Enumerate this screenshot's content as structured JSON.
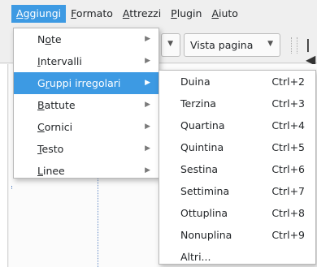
{
  "menubar": {
    "items": [
      {
        "label": "Aggiungi",
        "u": "A",
        "rest": "ggiungi",
        "active": true
      },
      {
        "label": "Formato",
        "u": "F",
        "rest": "ormato"
      },
      {
        "label": "Attrezzi",
        "u": "A",
        "rest": "ttrezzi"
      },
      {
        "label": "Plugin",
        "u": "P",
        "rest": "lugin"
      },
      {
        "label": "Aiuto",
        "u": "A",
        "rest": "iuto"
      }
    ]
  },
  "toolbar": {
    "view_combo": "Vista pagina",
    "combo_arrow_icon": "chevron-down-icon",
    "first_page_icon": "first-page-icon"
  },
  "menu": {
    "items": [
      {
        "label": "Note",
        "pre": "N",
        "u": "o",
        "post": "te"
      },
      {
        "label": "Intervalli",
        "pre": "",
        "u": "I",
        "post": "ntervalli"
      },
      {
        "label": "Gruppi irregolari",
        "pre": "G",
        "u": "r",
        "post": "uppi irregolari"
      },
      {
        "label": "Battute",
        "pre": "",
        "u": "B",
        "post": "attute"
      },
      {
        "label": "Cornici",
        "pre": "",
        "u": "C",
        "post": "ornici"
      },
      {
        "label": "Testo",
        "pre": "",
        "u": "T",
        "post": "esto"
      },
      {
        "label": "Linee",
        "pre": "",
        "u": "L",
        "post": "inee"
      }
    ]
  },
  "submenu": {
    "items": [
      {
        "label": "Duina",
        "shortcut": "Ctrl+2"
      },
      {
        "label": "Terzina",
        "shortcut": "Ctrl+3"
      },
      {
        "label": "Quartina",
        "shortcut": "Ctrl+4"
      },
      {
        "label": "Quintina",
        "shortcut": "Ctrl+5"
      },
      {
        "label": "Sestina",
        "shortcut": "Ctrl+6"
      },
      {
        "label": "Settimina",
        "shortcut": "Ctrl+7"
      },
      {
        "label": "Ottuplina",
        "shortcut": "Ctrl+8"
      },
      {
        "label": "Nonuplina",
        "shortcut": "Ctrl+9"
      },
      {
        "label": "Altri...",
        "shortcut": ""
      }
    ]
  },
  "colors": {
    "highlight": "#3d9ae3",
    "menu_bg": "#ffffff",
    "chrome_bg": "#efefef"
  }
}
